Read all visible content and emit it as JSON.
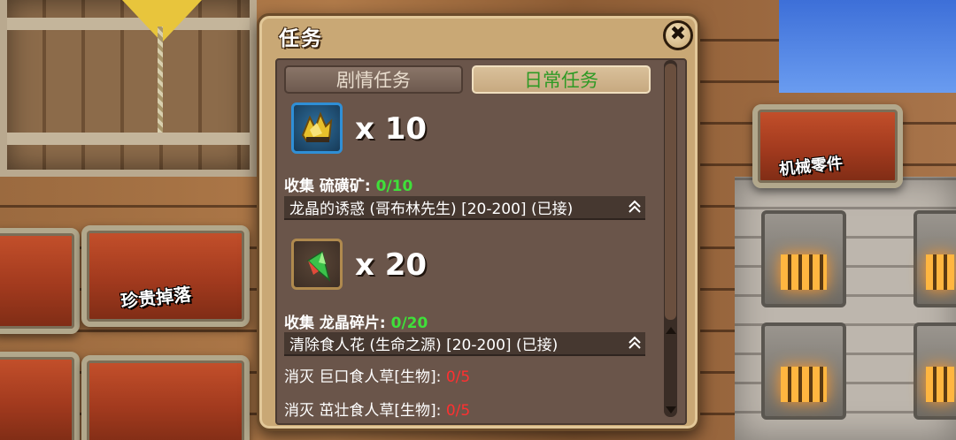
{
  "background": {
    "chest_left_1": "珍贵掉落",
    "chest_right": "机械零件"
  },
  "dialog": {
    "title": "任务",
    "close_icon": "close-x",
    "tabs": [
      {
        "label": "剧情任务",
        "active": false
      },
      {
        "label": "日常任务",
        "active": true
      }
    ],
    "rewards": [
      {
        "icon": "sulfur-ore-icon",
        "qty": "x 10"
      },
      {
        "icon": "dragon-crystal-shard-icon",
        "qty": "x 20"
      }
    ],
    "objectives": [
      {
        "prefix": "收集 硫磺矿: ",
        "count": "0/10",
        "color": "#3fe03a"
      },
      {
        "prefix": "收集 龙晶碎片: ",
        "count": "0/20",
        "color": "#3fe03a"
      },
      {
        "prefix": "消灭 巨口食人草[生物]: ",
        "count": "0/5",
        "color": "#ff3030"
      },
      {
        "prefix": "消灭 茁壮食人草[生物]: ",
        "count": "0/5",
        "color": "#ff3030"
      }
    ],
    "quests": [
      {
        "name": "龙晶的诱惑 (哥布林先生) [20-200]   (已接)"
      },
      {
        "name": "清除食人花 (生命之源) [20-200]   (已接)"
      }
    ]
  }
}
